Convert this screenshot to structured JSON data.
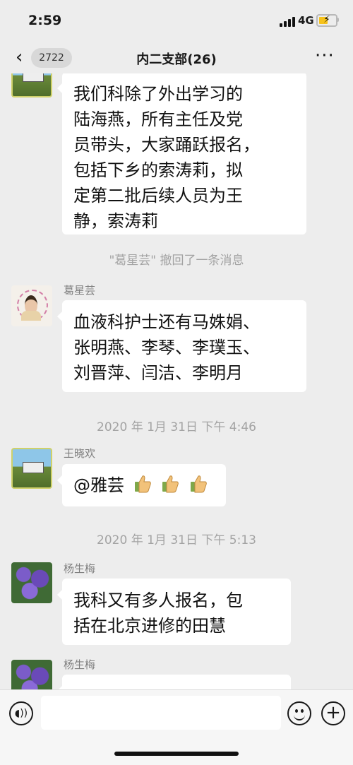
{
  "status": {
    "time": "2:59",
    "network": "4G"
  },
  "nav": {
    "back_count": "2722",
    "title": "内二支部(26)",
    "more": "···"
  },
  "messages": [
    {
      "text_lines": [
        "我们科除了外出学习的",
        "陆海燕，所有主任及党",
        "员带头，大家踊跃报名，",
        "包括下乡的索涛莉，拟",
        "定第二批后续人员为王",
        "静，索涛莉"
      ]
    },
    {
      "system": "\"葛星芸\" 撤回了一条消息"
    },
    {
      "sender": "葛星芸",
      "text_lines": [
        "血液科护士还有马姝娟、",
        "张明燕、李琴、李璞玉、",
        "刘晋萍、闫洁、李明月"
      ]
    },
    {
      "timestamp": "2020 年 1月 31日 下午 4:46"
    },
    {
      "sender": "王晓欢",
      "text": "@雅芸"
    },
    {
      "timestamp": "2020 年 1月 31日 下午 5:13"
    },
    {
      "sender": "杨生梅",
      "text_lines": [
        "我科又有多人报名，包",
        "括在北京进修的田慧"
      ]
    },
    {
      "sender": "杨生梅"
    }
  ]
}
